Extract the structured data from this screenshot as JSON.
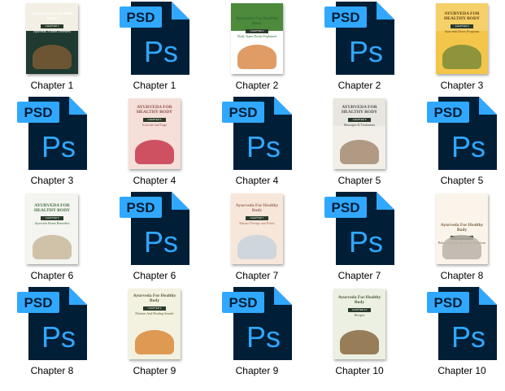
{
  "files": [
    {
      "type": "cover",
      "label": "Chapter 1",
      "cover": {
        "title": "Ayurveda For Healthy Body",
        "chapter": "CHAPTER 1",
        "subtitle": "Ayurveda: A Brief Overview",
        "style": "c1"
      }
    },
    {
      "type": "psd",
      "label": "Chapter 1",
      "badge": "PSD",
      "mark": "Ps"
    },
    {
      "type": "cover",
      "label": "Chapter 2",
      "cover": {
        "title": "Ayurveda For Healthy Body",
        "chapter": "CHAPTER 2",
        "subtitle": "Body Types Dosha Explained",
        "style": "c2"
      }
    },
    {
      "type": "psd",
      "label": "Chapter 2",
      "badge": "PSD",
      "mark": "Ps"
    },
    {
      "type": "cover",
      "label": "Chapter 3",
      "cover": {
        "title": "AYURVEDA FOR HEALTHY BODY",
        "chapter": "CHAPTER 3",
        "subtitle": "Ayurveda Detox Programs",
        "style": "c3"
      }
    },
    {
      "type": "psd",
      "label": "Chapter 3",
      "badge": "PSD",
      "mark": "Ps"
    },
    {
      "type": "cover",
      "label": "Chapter 4",
      "cover": {
        "title": "AYURVEDA FOR HEALTHY BODY",
        "chapter": "CHAPTER 4",
        "subtitle": "Exercise and Yoga",
        "style": "c4"
      }
    },
    {
      "type": "psd",
      "label": "Chapter 4",
      "badge": "PSD",
      "mark": "Ps"
    },
    {
      "type": "cover",
      "label": "Chapter 5",
      "cover": {
        "title": "AYURVEDA FOR HEALTHY BODY",
        "chapter": "CHAPTER 5",
        "subtitle": "Massages & Treatments",
        "style": "c5"
      }
    },
    {
      "type": "psd",
      "label": "Chapter 5",
      "badge": "PSD",
      "mark": "Ps"
    },
    {
      "type": "cover",
      "label": "Chapter 6",
      "cover": {
        "title": "AYURVEDA FOR HEALTHY BODY",
        "chapter": "CHAPTER 6",
        "subtitle": "Ayurveda Home Remedies",
        "style": "c6"
      }
    },
    {
      "type": "psd",
      "label": "Chapter 6",
      "badge": "PSD",
      "mark": "Ps"
    },
    {
      "type": "cover",
      "label": "Chapter 7",
      "cover": {
        "title": "Ayurveda For Healthy Body",
        "chapter": "CHAPTER 7",
        "subtitle": "Marma Therapy and Points",
        "style": "c7"
      }
    },
    {
      "type": "psd",
      "label": "Chapter 7",
      "badge": "PSD",
      "mark": "Ps"
    },
    {
      "type": "cover",
      "label": "Chapter 8",
      "cover": {
        "title": "Ayurveda For Healthy Body",
        "chapter": "CHAPTER 8",
        "subtitle": "Balancing Your Mind And Emotions",
        "style": "c8"
      }
    },
    {
      "type": "psd",
      "label": "Chapter 8",
      "badge": "PSD",
      "mark": "Ps"
    },
    {
      "type": "cover",
      "label": "Chapter 9",
      "cover": {
        "title": "Ayurveda For Healthy Body",
        "chapter": "CHAPTER 9",
        "subtitle": "Mantras And Healing Sounds",
        "style": "c9"
      }
    },
    {
      "type": "psd",
      "label": "Chapter 9",
      "badge": "PSD",
      "mark": "Ps"
    },
    {
      "type": "cover",
      "label": "Chapter 10",
      "cover": {
        "title": "Ayurveda For Healthy Body",
        "chapter": "CHAPTER 10",
        "subtitle": "Recipes",
        "style": "c10"
      }
    },
    {
      "type": "psd",
      "label": "Chapter 10",
      "badge": "PSD",
      "mark": "Ps"
    }
  ],
  "colors": {
    "psd_body": "#001e36",
    "psd_fold": "#31a8ff",
    "psd_badge": "#31a8ff",
    "psd_text": "#31a8ff",
    "label_text": "#000000",
    "background": "#ffffff"
  },
  "icons": {
    "psd": "photoshop-file-icon",
    "cover": "ebook-cover-thumbnail"
  }
}
